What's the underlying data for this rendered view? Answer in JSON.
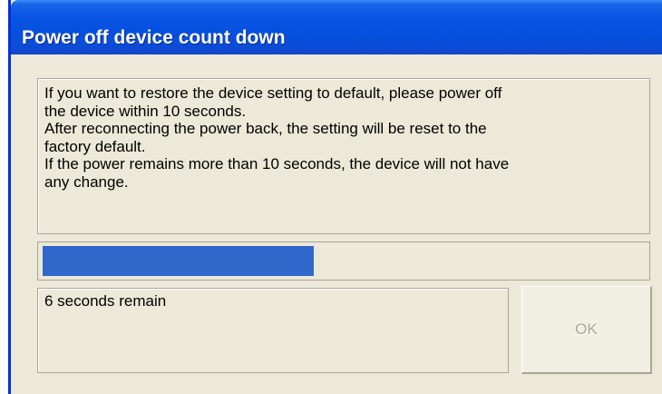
{
  "window": {
    "title": "Power off device count down"
  },
  "message": {
    "lines": [
      "If you want to restore the device setting to default, please power off",
      "the device within 10 seconds.",
      "After reconnecting the power back, the setting will be reset to the",
      "factory default.",
      "If the power remains more than 10 seconds, the device will not have",
      "any change."
    ]
  },
  "progress": {
    "fraction": 0.45
  },
  "status": {
    "text": "6 seconds remain"
  },
  "buttons": {
    "ok_label": "OK"
  },
  "colors": {
    "titlebar": "#0a55e3",
    "progress_fill": "#3168cb",
    "dialog_background": "#ece9d8"
  }
}
